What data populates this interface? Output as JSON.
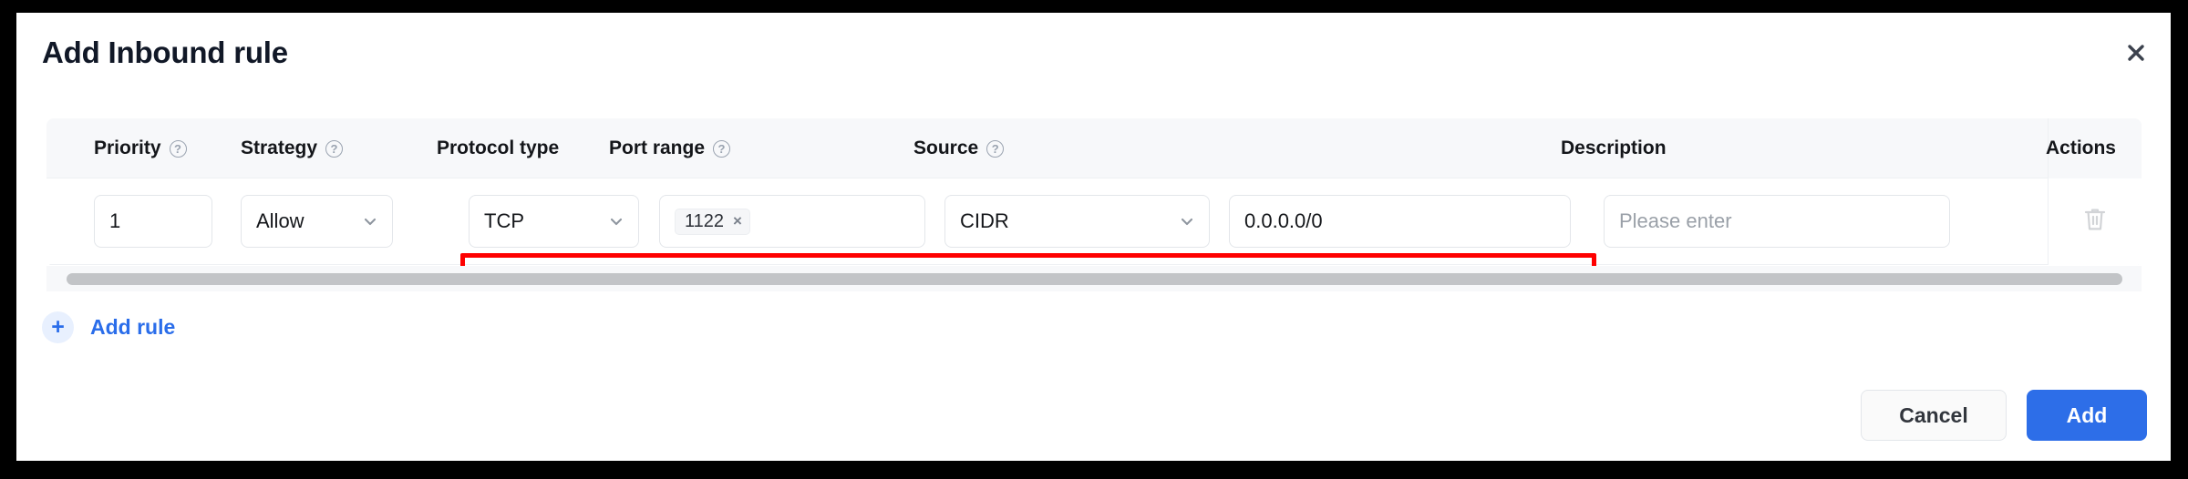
{
  "dialog": {
    "title": "Add Inbound rule",
    "close_icon": "close-icon"
  },
  "table": {
    "columns": [
      {
        "label": "Priority",
        "help": true,
        "help_glyph": "?"
      },
      {
        "label": "Strategy",
        "help": true,
        "help_glyph": "?"
      },
      {
        "label": "Protocol type",
        "help": false,
        "help_glyph": ""
      },
      {
        "label": "Port range",
        "help": true,
        "help_glyph": "?"
      },
      {
        "label": "Source",
        "help": true,
        "help_glyph": "?"
      },
      {
        "label": "Description",
        "help": false,
        "help_glyph": ""
      },
      {
        "label": "Actions",
        "help": false,
        "help_glyph": ""
      }
    ],
    "row": {
      "priority_value": "1",
      "strategy_value": "Allow",
      "protocol_value": "TCP",
      "port_tag": "1122",
      "port_tag_remove": "×",
      "source_type_value": "CIDR",
      "source_value": "0.0.0.0/0",
      "description_placeholder": "Please enter",
      "delete_icon": "trash-icon"
    }
  },
  "scrollbar": {
    "orientation": "horizontal"
  },
  "add_rule": {
    "plus_glyph": "+",
    "label": "Add rule"
  },
  "footer": {
    "cancel_label": "Cancel",
    "add_label": "Add"
  },
  "colors": {
    "primary": "#2d6ee8",
    "link": "#2a6dea",
    "highlight": "#fe0000",
    "header_bg": "#f7f8fa",
    "border": "#e3e6ea",
    "placeholder": "#9aa0a8",
    "backdrop": "#000000"
  }
}
